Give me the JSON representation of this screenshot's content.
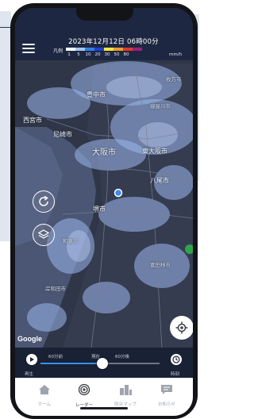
{
  "topbar": {
    "datetime": "2023年12月12日 06時00分",
    "legend": {
      "label": "凡例",
      "ticks": [
        "1",
        "5",
        "10",
        "20",
        "30",
        "50",
        "80"
      ],
      "unit": "mm/h",
      "colors": [
        "#ffffff",
        "#a0c8f0",
        "#2f82e6",
        "#1f3fd6",
        "#f5e63a",
        "#f29a2e",
        "#e23a2a",
        "#a0207a"
      ]
    }
  },
  "map": {
    "cities": {
      "hirakata": "枚方市",
      "toyonaka": "豊中市",
      "nishinomiya": "西宮市",
      "amagasaki": "尼崎市",
      "osaka": "大阪市",
      "higashiosaka": "東大阪市",
      "yao": "八尾市",
      "sakai": "堺市",
      "izumi": "和泉市",
      "tondabayashi": "富田林市",
      "kishiwada": "岸和田市",
      "neyagawa": "寝屋川市"
    },
    "attribution": "Google"
  },
  "timeline": {
    "past_label": "60分前",
    "now_label": "現在",
    "future_label": "60分後",
    "play_label": "再生",
    "right_label": "時刻",
    "position_percent": 52
  },
  "nav": {
    "items": [
      {
        "label": "ホーム"
      },
      {
        "label": "レーダー"
      },
      {
        "label": "防災マップ"
      },
      {
        "label": "お知らせ"
      }
    ]
  }
}
